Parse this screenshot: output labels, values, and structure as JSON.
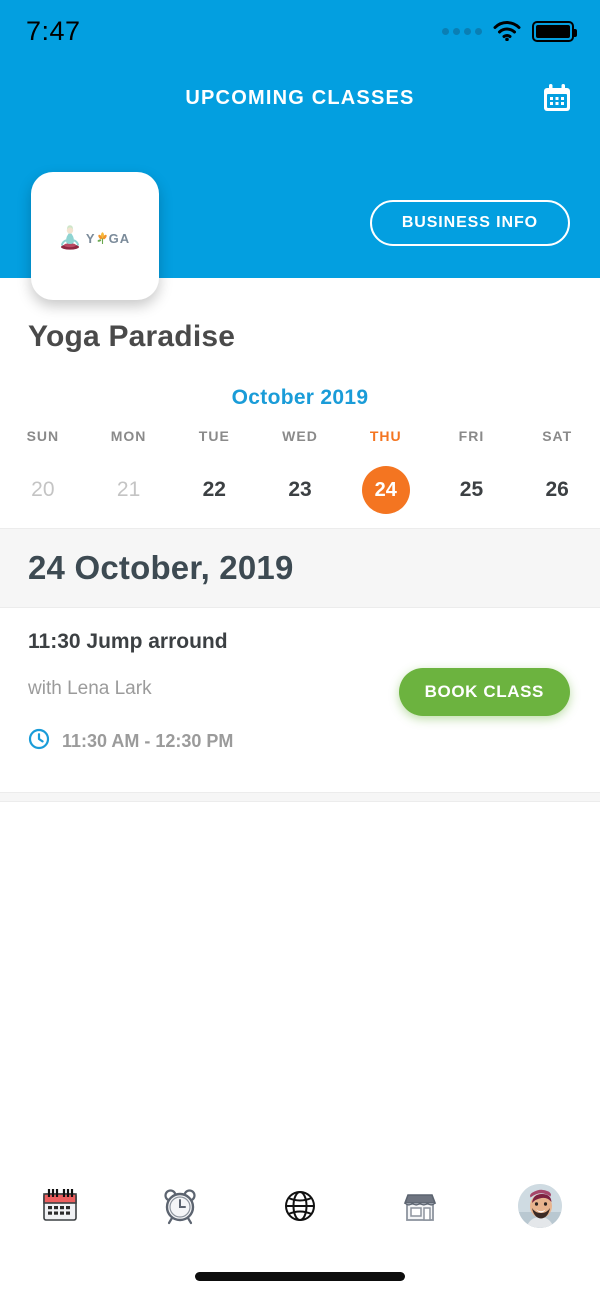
{
  "status_bar": {
    "time": "7:47",
    "signal_icon": "signal-dots-icon",
    "wifi_icon": "wifi-icon",
    "battery_icon": "battery-full-icon"
  },
  "header": {
    "title": "UPCOMING CLASSES",
    "calendar_icon": "calendar-icon",
    "background_color": "#039fe0"
  },
  "business": {
    "logo_text_left": "Y",
    "logo_text_right": "GA",
    "logo_icon": "yoga-logo-icon",
    "info_button_label": "BUSINESS INFO",
    "name": "Yoga Paradise"
  },
  "calendar": {
    "month_label": "October 2019",
    "month_color": "#1a9cd8",
    "selected_color": "#f47521",
    "days": [
      {
        "dow": "SUN",
        "date": "20",
        "state": "past"
      },
      {
        "dow": "MON",
        "date": "21",
        "state": "past"
      },
      {
        "dow": "TUE",
        "date": "22",
        "state": "normal"
      },
      {
        "dow": "WED",
        "date": "23",
        "state": "normal"
      },
      {
        "dow": "THU",
        "date": "24",
        "state": "selected"
      },
      {
        "dow": "FRI",
        "date": "25",
        "state": "normal"
      },
      {
        "dow": "SAT",
        "date": "26",
        "state": "normal"
      }
    ]
  },
  "schedule": {
    "date_heading": "24 October, 2019",
    "classes": [
      {
        "title": "11:30 Jump arround",
        "instructor": "with Lena Lark",
        "time_range": "11:30 AM - 12:30 PM",
        "clock_icon": "clock-icon",
        "book_button_label": "BOOK CLASS",
        "book_button_color": "#6cb33f"
      }
    ]
  },
  "tab_bar": {
    "items": [
      {
        "icon": "calendar-tab-icon",
        "name": "schedule"
      },
      {
        "icon": "alarm-clock-tab-icon",
        "name": "reminders"
      },
      {
        "icon": "globe-tab-icon",
        "name": "explore"
      },
      {
        "icon": "storefront-tab-icon",
        "name": "shop"
      },
      {
        "icon": "avatar-tab-icon",
        "name": "profile"
      }
    ]
  }
}
